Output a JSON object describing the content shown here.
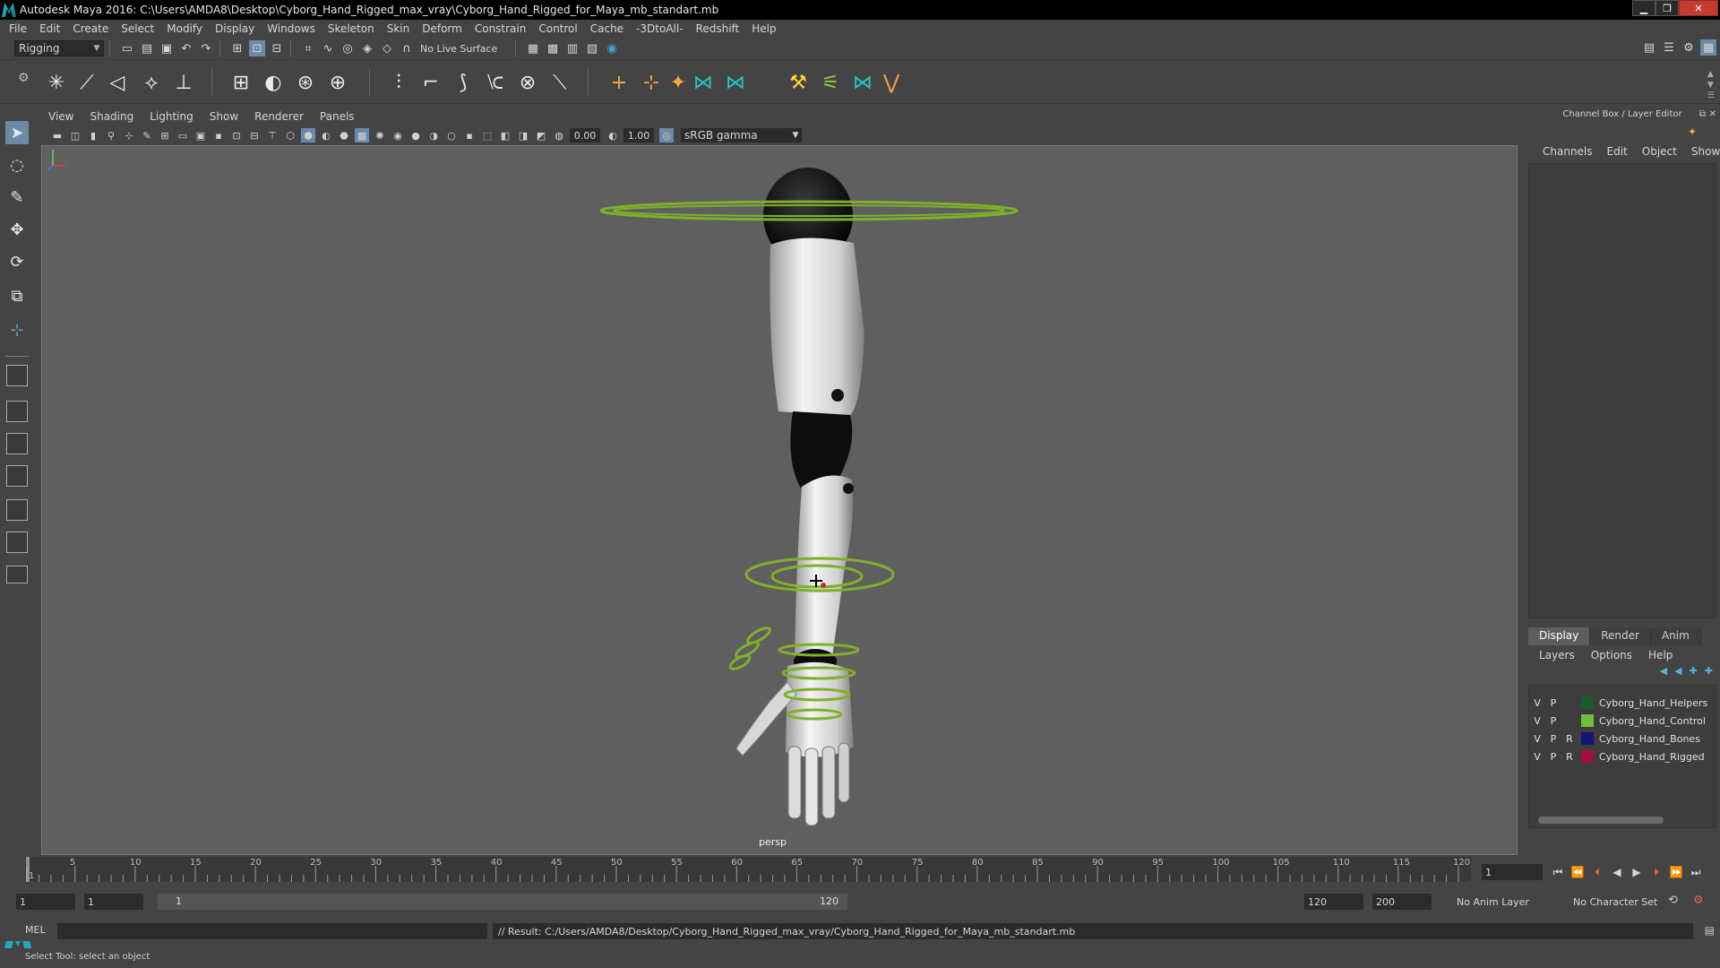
{
  "window": {
    "title": "Autodesk Maya 2016: C:\\Users\\AMDA8\\Desktop\\Cyborg_Hand_Rigged_max_vray\\Cyborg_Hand_Rigged_for_Maya_mb_standart.mb",
    "minimize": "▁",
    "maximize": "❐",
    "close": "✕"
  },
  "menubar": [
    "File",
    "Edit",
    "Create",
    "Select",
    "Modify",
    "Display",
    "Windows",
    "Skeleton",
    "Skin",
    "Deform",
    "Constrain",
    "Control",
    "Cache",
    "-3DtoAll-",
    "Redshift",
    "Help"
  ],
  "statusline": {
    "mode": "Rigging",
    "live_surface": "No Live Surface"
  },
  "panel": {
    "menus": [
      "View",
      "Shading",
      "Lighting",
      "Show",
      "Renderer",
      "Panels"
    ],
    "exposure": "0.00",
    "gamma": "1.00",
    "color_space": "sRGB gamma",
    "camera": "persp"
  },
  "channel_box": {
    "title": "Channel Box / Layer Editor",
    "tabs": [
      "Channels",
      "Edit",
      "Object",
      "Show"
    ]
  },
  "layer_editor": {
    "tabs": [
      "Display",
      "Render",
      "Anim"
    ],
    "active_tab": "Display",
    "menus": [
      "Layers",
      "Options",
      "Help"
    ],
    "layers": [
      {
        "v": "V",
        "p": "P",
        "r": "",
        "name": "Cyborg_Hand_Helpers",
        "color": "#1d5a2a"
      },
      {
        "v": "V",
        "p": "P",
        "r": "",
        "name": "Cyborg_Hand_Control",
        "color": "#6fbf3a"
      },
      {
        "v": "V",
        "p": "P",
        "r": "R",
        "name": "Cyborg_Hand_Bones",
        "color": "#13137a"
      },
      {
        "v": "V",
        "p": "P",
        "r": "R",
        "name": "Cyborg_Hand_Rigged",
        "color": "#a0103a"
      }
    ]
  },
  "timeline": {
    "ticks": [
      1,
      5,
      10,
      15,
      20,
      25,
      30,
      35,
      40,
      45,
      50,
      55,
      60,
      65,
      70,
      75,
      80,
      85,
      90,
      95,
      100,
      105,
      110,
      115,
      120
    ],
    "current_frame": "1",
    "range_start_outer": "1",
    "range_start": "1",
    "range_bar_start": "1",
    "range_bar_end": "120",
    "range_end": "120",
    "range_end_outer": "200",
    "anim_layer": "No Anim Layer",
    "character_set": "No Character Set"
  },
  "command_line": {
    "label": "MEL",
    "result": "// Result: C:/Users/AMDA8/Desktop/Cyborg_Hand_Rigged_max_vray/Cyborg_Hand_Rigged_for_Maya_mb_standart.mb"
  },
  "help_line": "Select Tool: select an object",
  "colors": {
    "control_curve": "#7fb02a",
    "viewport_bg": "#5f5f5f",
    "accent": "#6a8aa8"
  }
}
